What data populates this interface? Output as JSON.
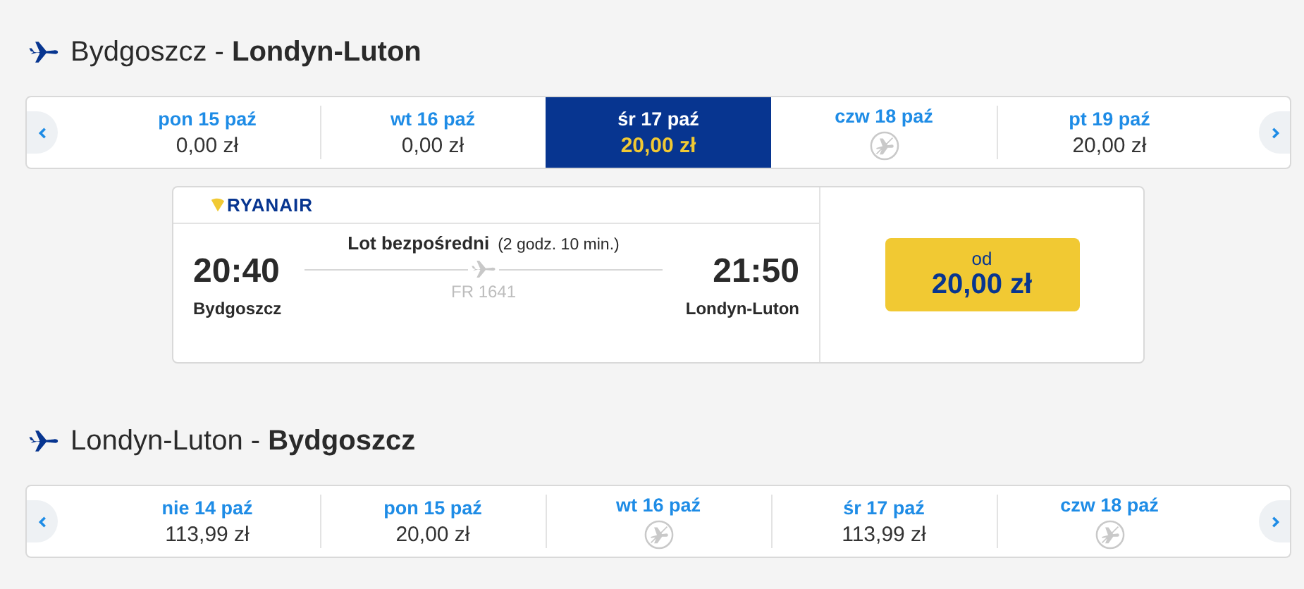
{
  "outbound": {
    "from": "Bydgoszcz",
    "separator": "-",
    "to": "Londyn-Luton",
    "days": [
      {
        "date": "pon 15 paź",
        "kind": "price",
        "price": "0,00 zł",
        "selected": false
      },
      {
        "date": "wt 16 paź",
        "kind": "price",
        "price": "0,00 zł",
        "selected": false
      },
      {
        "date": "śr 17 paź",
        "kind": "price",
        "price": "20,00 zł",
        "selected": true
      },
      {
        "date": "czw 18 paź",
        "kind": "no_flight",
        "selected": false
      },
      {
        "date": "pt 19 paź",
        "kind": "price",
        "price": "20,00 zł",
        "selected": false
      }
    ],
    "flight": {
      "airline": "RYANAIR",
      "type": "Lot bezpośredni",
      "duration": "(2 godz. 10 min.)",
      "depart_time": "20:40",
      "depart_city": "Bydgoszcz",
      "arrive_time": "21:50",
      "arrive_city": "Londyn-Luton",
      "flight_number": "FR 1641",
      "price_label": "od",
      "price": "20,00 zł"
    }
  },
  "return": {
    "from": "Londyn-Luton",
    "separator": "-",
    "to": "Bydgoszcz",
    "days": [
      {
        "date": "nie 14 paź",
        "kind": "price",
        "price": "113,99 zł",
        "selected": false
      },
      {
        "date": "pon 15 paź",
        "kind": "price",
        "price": "20,00 zł",
        "selected": false
      },
      {
        "date": "wt 16 paź",
        "kind": "no_flight",
        "selected": false
      },
      {
        "date": "śr 17 paź",
        "kind": "price",
        "price": "113,99 zł",
        "selected": false
      },
      {
        "date": "czw 18 paź",
        "kind": "no_flight",
        "selected": false
      }
    ]
  }
}
